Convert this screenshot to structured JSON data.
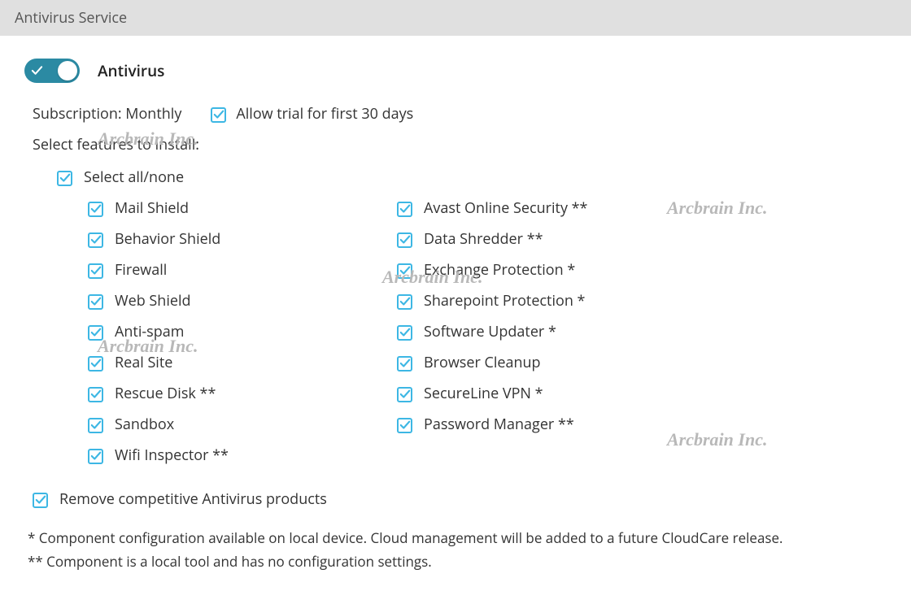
{
  "header": {
    "title": "Antivirus Service"
  },
  "toggle": {
    "label": "Antivirus"
  },
  "subscription": {
    "label": "Subscription: Monthly",
    "trial_label": "Allow trial for first 30 days"
  },
  "select_features_label": "Select features to install:",
  "select_all_label": "Select all/none",
  "features_col1": [
    "Mail Shield",
    "Behavior Shield",
    "Firewall",
    "Web Shield",
    "Anti-spam",
    "Real Site",
    "Rescue Disk **",
    "Sandbox",
    "Wifi Inspector **"
  ],
  "features_col2": [
    "Avast Online Security **",
    "Data Shredder **",
    "Exchange Protection *",
    "Sharepoint Protection *",
    "Software Updater *",
    "Browser Cleanup",
    "SecureLine VPN *",
    "Password Manager **"
  ],
  "remove_label": "Remove competitive Antivirus products",
  "footnote1": "* Component configuration available on local device. Cloud management will be added to a future CloudCare release.",
  "footnote2": "** Component is a local tool and has no configuration settings.",
  "watermark": "Arcbrain Inc."
}
